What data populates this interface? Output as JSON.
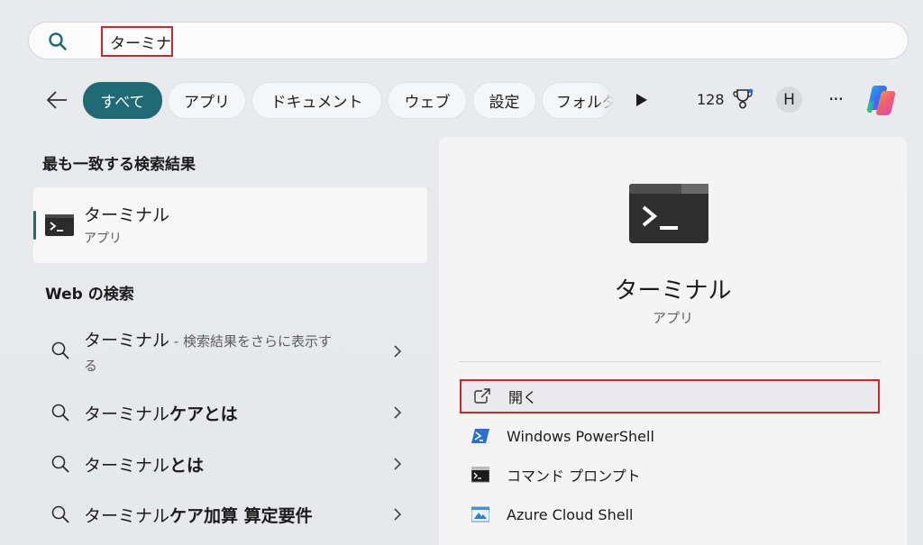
{
  "search": {
    "query": "ターミナル"
  },
  "filters": [
    {
      "label": "すべて",
      "active": true
    },
    {
      "label": "アプリ",
      "active": false
    },
    {
      "label": "ドキュメント",
      "active": false
    },
    {
      "label": "ウェブ",
      "active": false
    },
    {
      "label": "設定",
      "active": false
    },
    {
      "label": "フォルダー",
      "active": false
    }
  ],
  "header": {
    "points": "128",
    "avatar_initial": "H",
    "more": "···"
  },
  "best_match": {
    "title": "最も一致する検索結果",
    "name": "ターミナル",
    "type": "アプリ"
  },
  "web": {
    "title": "Web の検索",
    "items": [
      {
        "base": "ターミナル",
        "bold": "",
        "suffix": " - 検索結果をさらに表示す",
        "suffix2": "る"
      },
      {
        "base": "ターミナル",
        "bold": "ケアとは"
      },
      {
        "base": "ターミナル",
        "bold": "とは"
      },
      {
        "base": "ターミナル",
        "bold": "ケア加算 算定要件"
      }
    ]
  },
  "detail": {
    "name": "ターミナル",
    "type": "アプリ",
    "actions": [
      {
        "label": "開く",
        "icon": "open-external-icon"
      },
      {
        "label": "Windows PowerShell",
        "icon": "powershell-icon"
      },
      {
        "label": "コマンド プロンプト",
        "icon": "command-prompt-icon"
      },
      {
        "label": "Azure Cloud Shell",
        "icon": "azure-cloud-shell-icon"
      }
    ]
  },
  "colors": {
    "accent": "#1f6a74",
    "highlight": "#d0262b"
  }
}
